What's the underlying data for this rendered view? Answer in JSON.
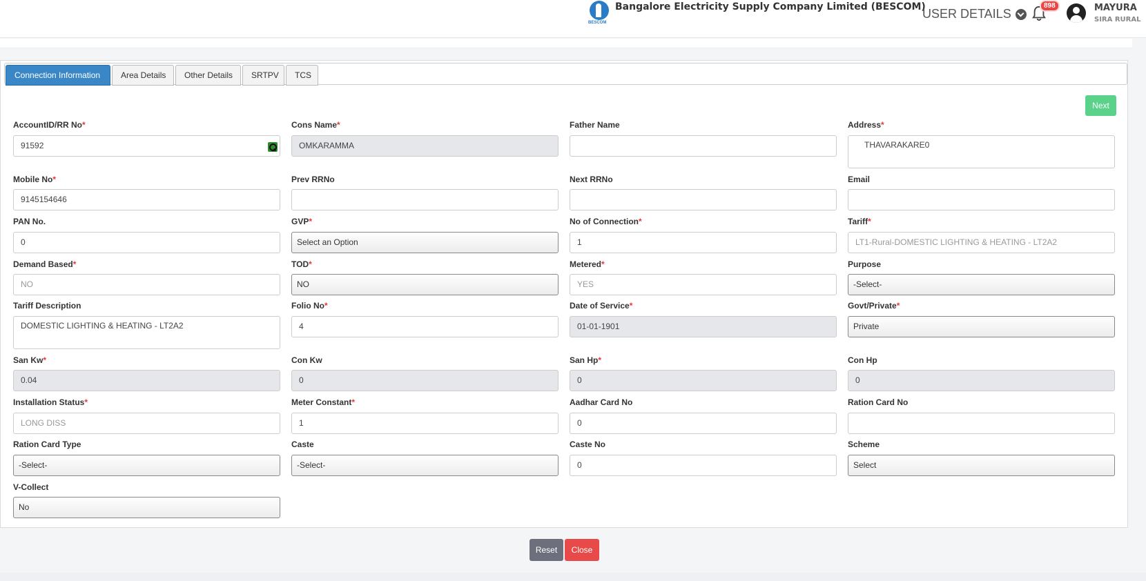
{
  "header": {
    "company_name": "Bangalore Electricity Supply Company Limited (BESCOM)",
    "logo_text": "BESCOM",
    "user_details_label": "USER DETAILS",
    "notification_count": "898",
    "user_name": "MAYURA",
    "user_location": "SIRA RURAL"
  },
  "tabs": [
    {
      "label": "Connection Information",
      "active": true
    },
    {
      "label": "Area Details",
      "active": false
    },
    {
      "label": "Other Details",
      "active": false
    },
    {
      "label": "SRTPV",
      "active": false
    },
    {
      "label": "TCS",
      "active": false
    }
  ],
  "next_label": "Next",
  "fields": {
    "account_id": {
      "label": "AccountID/RR No",
      "value": "91592"
    },
    "cons_name": {
      "label": "Cons Name",
      "value": "OMKARAMMA"
    },
    "father_name": {
      "label": "Father Name",
      "value": ""
    },
    "address": {
      "label": "Address",
      "value": "THAVARAKARE0"
    },
    "mobile_no": {
      "label": "Mobile No",
      "value": "9145154646"
    },
    "prev_rrno": {
      "label": "Prev RRNo",
      "value": ""
    },
    "next_rrno": {
      "label": "Next RRNo",
      "value": ""
    },
    "email": {
      "label": "Email",
      "value": ""
    },
    "pan_no": {
      "label": "PAN No.",
      "value": "0"
    },
    "gvp": {
      "label": "GVP",
      "value": "Select an Option"
    },
    "no_of_connection": {
      "label": "No of Connection",
      "value": "1"
    },
    "tariff": {
      "label": "Tariff",
      "value": "LT1-Rural-DOMESTIC LIGHTING & HEATING - LT2A2"
    },
    "demand_based": {
      "label": "Demand Based",
      "value": "NO"
    },
    "tod": {
      "label": "TOD",
      "value": "NO"
    },
    "metered": {
      "label": "Metered",
      "value": "YES"
    },
    "purpose": {
      "label": "Purpose",
      "value": "-Select-"
    },
    "tariff_description": {
      "label": "Tariff Description",
      "value": "DOMESTIC LIGHTING & HEATING - LT2A2"
    },
    "folio_no": {
      "label": "Folio No",
      "value": "4"
    },
    "date_of_service": {
      "label": "Date of Service",
      "value": "01-01-1901"
    },
    "govt_private": {
      "label": "Govt/Private",
      "value": "Private"
    },
    "san_kw": {
      "label": "San Kw",
      "value": "0.04"
    },
    "con_kw": {
      "label": "Con Kw",
      "value": "0"
    },
    "san_hp": {
      "label": "San Hp",
      "value": "0"
    },
    "con_hp": {
      "label": "Con Hp",
      "value": "0"
    },
    "installation_status": {
      "label": "Installation Status",
      "value": "LONG DISS"
    },
    "meter_constant": {
      "label": "Meter Constant",
      "value": "1"
    },
    "aadhar_card_no": {
      "label": "Aadhar Card No",
      "value": "0"
    },
    "ration_card_no": {
      "label": "Ration Card No",
      "value": ""
    },
    "ration_card_type": {
      "label": "Ration Card Type",
      "value": "-Select-"
    },
    "caste": {
      "label": "Caste",
      "value": "-Select-"
    },
    "caste_no": {
      "label": "Caste No",
      "value": "0"
    },
    "scheme": {
      "label": "Scheme",
      "value": "Select"
    },
    "v_collect": {
      "label": "V-Collect",
      "value": "No"
    }
  },
  "required_marker": "*",
  "buttons": {
    "reset": "Reset",
    "close": "Close"
  },
  "colors": {
    "tab_active": "#3a87c8",
    "next": "#5bd28a",
    "reset": "#6e6f7d",
    "close": "#e84a4a",
    "required": "#e53935"
  }
}
